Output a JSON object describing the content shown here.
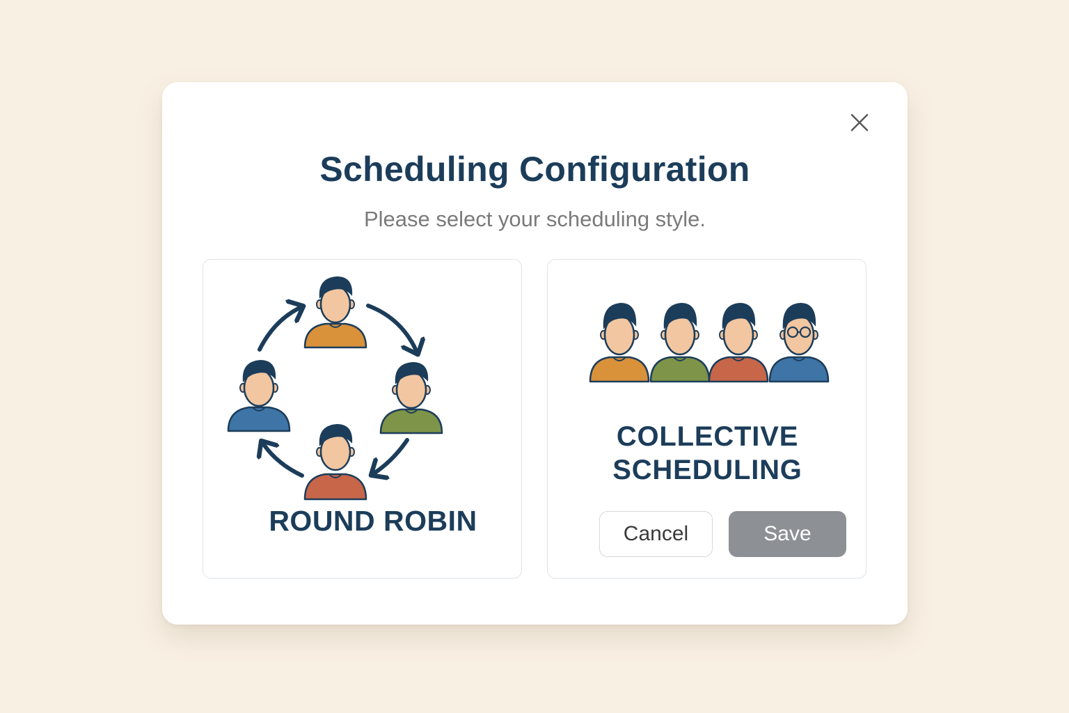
{
  "dialog": {
    "title": "Scheduling Configuration",
    "subtitle": "Please select your scheduling style.",
    "close_icon": "close-icon"
  },
  "options": {
    "round_robin": {
      "label": "ROUND ROBIN",
      "icon": "round-robin-icon"
    },
    "collective": {
      "label_line1": "COLLECTIVE",
      "label_line2": "SCHEDULING",
      "icon": "group-icon"
    }
  },
  "actions": {
    "cancel_label": "Cancel",
    "save_label": "Save"
  },
  "colors": {
    "background": "#f9f0e4",
    "title": "#1c3d5a",
    "save_button": "#8d9094",
    "person_orange": "#d9913a",
    "person_green": "#7e9448",
    "person_red": "#c8664a",
    "person_blue": "#3f74a6"
  }
}
